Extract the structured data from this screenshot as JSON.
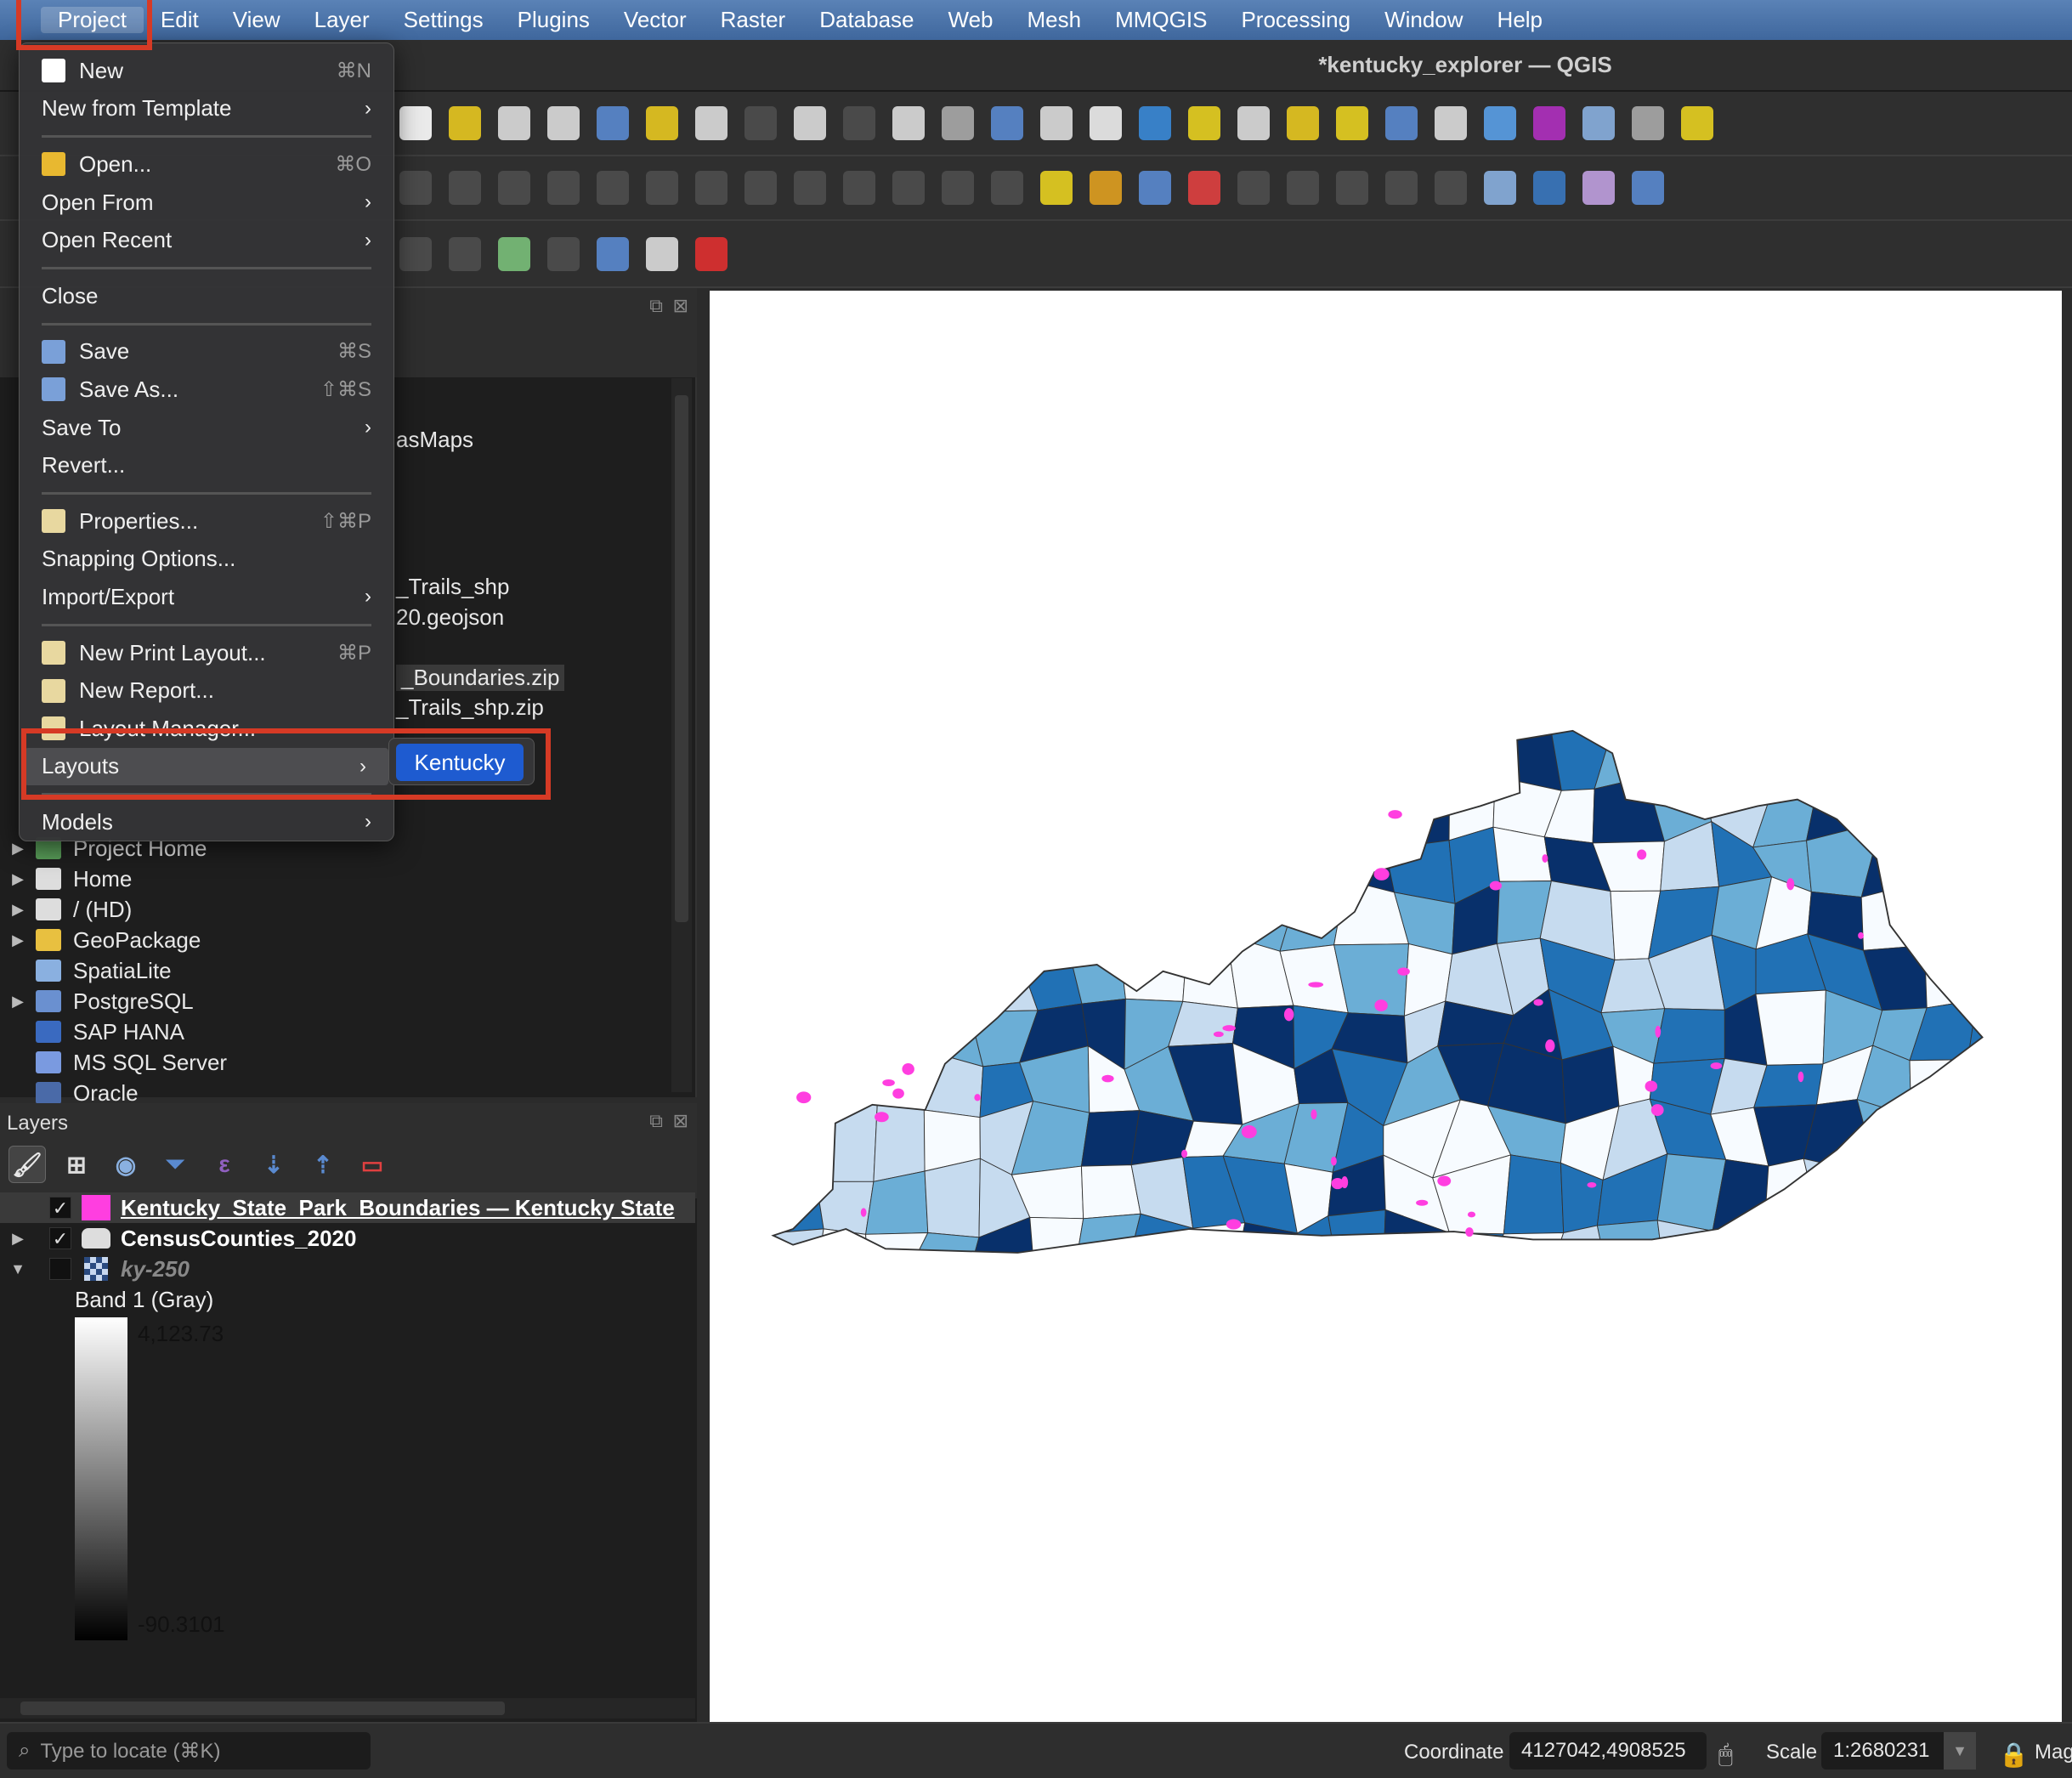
{
  "window_title": "*kentucky_explorer — QGIS",
  "menubar": [
    "Project",
    "Edit",
    "View",
    "Layer",
    "Settings",
    "Plugins",
    "Vector",
    "Raster",
    "Database",
    "Web",
    "Mesh",
    "MMQGIS",
    "Processing",
    "Window",
    "Help"
  ],
  "project_menu": [
    {
      "label": "New",
      "shortcut": "⌘N",
      "icon": "new-file-icon"
    },
    {
      "label": "New from Template",
      "submenu": true
    },
    {
      "sep": true
    },
    {
      "label": "Open...",
      "shortcut": "⌘O",
      "icon": "folder-icon"
    },
    {
      "label": "Open From",
      "submenu": true
    },
    {
      "label": "Open Recent",
      "submenu": true
    },
    {
      "sep": true
    },
    {
      "label": "Close"
    },
    {
      "sep": true
    },
    {
      "label": "Save",
      "shortcut": "⌘S",
      "icon": "save-icon"
    },
    {
      "label": "Save As...",
      "shortcut": "⇧⌘S",
      "icon": "save-as-icon"
    },
    {
      "label": "Save To",
      "submenu": true
    },
    {
      "label": "Revert..."
    },
    {
      "sep": true
    },
    {
      "label": "Properties...",
      "shortcut": "⇧⌘P",
      "icon": "properties-icon"
    },
    {
      "label": "Snapping Options..."
    },
    {
      "label": "Import/Export",
      "submenu": true
    },
    {
      "sep": true
    },
    {
      "label": "New Print Layout...",
      "shortcut": "⌘P",
      "icon": "print-layout-icon"
    },
    {
      "label": "New Report...",
      "icon": "report-icon"
    },
    {
      "label": "Layout Manager...",
      "icon": "layout-manager-icon"
    },
    {
      "label": "Layouts",
      "submenu": true,
      "highlighted": true
    },
    {
      "sep": true
    },
    {
      "label": "Models",
      "submenu": true
    }
  ],
  "layouts_submenu": [
    "Kentucky"
  ],
  "toolbars": [
    [
      [
        "pan-icon",
        "#fff"
      ],
      [
        "pan-to-selection-icon",
        "#e8c820"
      ],
      [
        "zoom-in-icon",
        "#ddd"
      ],
      [
        "zoom-out-icon",
        "#ddd"
      ],
      [
        "zoom-full-icon",
        "#5a8ad0"
      ],
      [
        "zoom-to-selection-icon",
        "#e8c820"
      ],
      [
        "zoom-to-layer-icon",
        "#ddd"
      ],
      [
        "zoom-native-icon",
        "#666"
      ],
      [
        "zoom-last-icon",
        "#ddd"
      ],
      [
        "zoom-next-icon",
        "#666"
      ],
      [
        "new-map-view-icon",
        "#ddd"
      ],
      [
        "new-3d-view-icon",
        "#aaa"
      ],
      [
        "bookmark-icon",
        "#5a8ad0"
      ],
      [
        "show-bookmarks-icon",
        "#ddd"
      ],
      [
        "temporal-icon",
        "#eee"
      ],
      [
        "refresh-icon",
        "#3a8ad8"
      ],
      [
        "select-features-icon",
        "#e8d020"
      ],
      [
        "select-by-value-icon",
        "#ddd"
      ],
      [
        "deselect-icon",
        "#e8c820"
      ],
      [
        "select-location-icon",
        "#e8d020"
      ],
      [
        "identify-icon",
        "#5a8ad0"
      ],
      [
        "attribute-table-icon",
        "#ddd"
      ],
      [
        "settings-icon",
        "#5aa0e8"
      ],
      [
        "statistics-icon",
        "#b030c0"
      ],
      [
        "table-icon",
        "#8ab0e0"
      ],
      [
        "measure-icon",
        "#aaa"
      ],
      [
        "annotation-icon",
        "#e8d020"
      ]
    ],
    [
      [
        "edit-pencil-icon",
        "#666"
      ],
      [
        "toggle-edit-icon",
        "#666"
      ],
      [
        "save-edits-icon",
        "#666"
      ],
      [
        "digitize-icon",
        "#666"
      ],
      [
        "add-polygon-icon",
        "#666"
      ],
      [
        "vertex-tool-icon",
        "#666"
      ],
      [
        "modify-attributes-icon",
        "#666"
      ],
      [
        "delete-icon",
        "#666"
      ],
      [
        "cut-icon",
        "#666"
      ],
      [
        "copy-icon",
        "#666"
      ],
      [
        "paste-icon",
        "#666"
      ],
      [
        "undo-icon",
        "#666"
      ],
      [
        "redo-icon",
        "#666"
      ],
      [
        "label-icon",
        "#e8d020"
      ],
      [
        "diagram-icon",
        "#e0a020"
      ],
      [
        "label-pin-icon",
        "#5a8ad0"
      ],
      [
        "label-red-icon",
        "#e04040"
      ],
      [
        "label-show-icon",
        "#666"
      ],
      [
        "label-move-icon",
        "#666"
      ],
      [
        "label-rotate-icon",
        "#666"
      ],
      [
        "label-change-icon",
        "#666"
      ],
      [
        "label-edit-icon",
        "#666"
      ],
      [
        "globe-icon",
        "#8ab0e0"
      ],
      [
        "python-icon",
        "#3a78c0"
      ],
      [
        "grid-icon",
        "#c0a0e0"
      ],
      [
        "help-icon",
        "#5a8ad0"
      ]
    ],
    [
      [
        "digitize-tool-icon",
        "#666"
      ],
      [
        "add-feature-icon",
        "#666"
      ],
      [
        "add-ring-icon",
        "#7ac07a"
      ],
      [
        "split-icon",
        "#666"
      ],
      [
        "info-icon",
        "#5a8ad0"
      ],
      [
        "tool-icon",
        "#ddd"
      ],
      [
        "gauge-icon",
        "#e03030"
      ]
    ]
  ],
  "browser": {
    "fragments": [
      "asMaps",
      "_Trails_shp",
      "20.geojson",
      "_Boundaries.zip",
      "_Trails_shp.zip"
    ],
    "items": [
      {
        "label": "Project Home",
        "icon": "project-home-icon",
        "expandable": true
      },
      {
        "label": "Home",
        "icon": "home-icon",
        "expandable": true
      },
      {
        "label": "/ (HD)",
        "icon": "drive-folder-icon",
        "expandable": true
      },
      {
        "label": "GeoPackage",
        "icon": "geopackage-icon",
        "expandable": true
      },
      {
        "label": "SpatiaLite",
        "icon": "spatialite-icon",
        "expandable": false
      },
      {
        "label": "PostgreSQL",
        "icon": "postgresql-icon",
        "expandable": true
      },
      {
        "label": "SAP HANA",
        "icon": "sap-hana-icon",
        "expandable": false
      },
      {
        "label": "MS SQL Server",
        "icon": "mssql-icon",
        "expandable": false
      },
      {
        "label": "Oracle",
        "icon": "oracle-icon",
        "expandable": false
      }
    ]
  },
  "layers": {
    "title": "Layers",
    "items": [
      {
        "label": "Kentucky_State_Park_Boundaries — Kentucky State",
        "checked": true,
        "swatch": "#ff3ee0"
      },
      {
        "label": "CensusCounties_2020",
        "checked": true
      },
      {
        "label": "ky-250",
        "checked": false
      }
    ],
    "band_label": "Band 1 (Gray)",
    "band_max": "4,123.73",
    "band_min": "-90.3101"
  },
  "map": {
    "palette": [
      "#f7fbff",
      "#c6dbef",
      "#6baed6",
      "#2171b5",
      "#08306b"
    ],
    "park_color": "#ff3ee0"
  },
  "status": {
    "locator_placeholder": "Type to locate (⌘K)",
    "coordinate_label": "Coordinate",
    "coordinate_value": "4127042,4908525",
    "scale_label": "Scale",
    "scale_value": "1:2680231",
    "magnifier_label": "Mag"
  }
}
